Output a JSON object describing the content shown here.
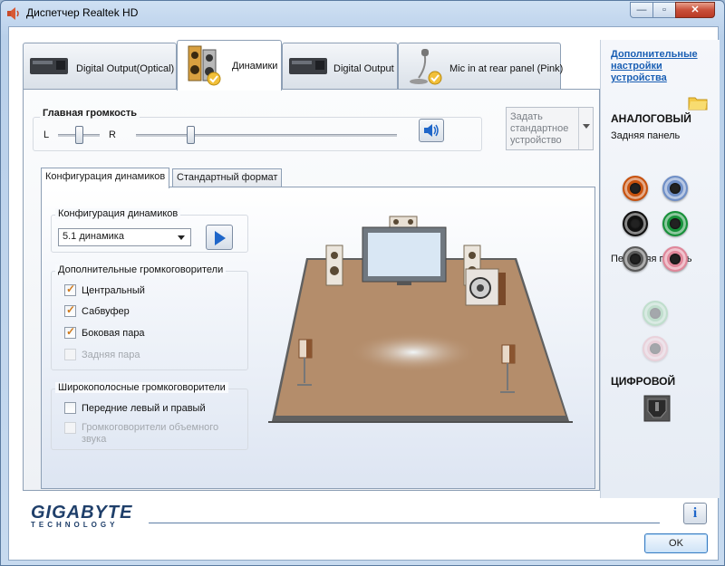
{
  "window": {
    "title": "Диспетчер Realtek HD"
  },
  "main_tabs": [
    {
      "label": "Digital Output(Optical)",
      "active": false
    },
    {
      "label": "Динамики",
      "active": true
    },
    {
      "label": "Digital Output",
      "active": false
    },
    {
      "label": "Mic in at rear panel (Pink)",
      "active": false
    }
  ],
  "volume": {
    "title": "Главная громкость",
    "left_label": "L",
    "right_label": "R",
    "balance_percent": 50,
    "level_percent": 21
  },
  "default_device": {
    "label": "Задать стандартное устройство"
  },
  "sub_tabs": [
    {
      "label": "Конфигурация динамиков",
      "active": true
    },
    {
      "label": "Стандартный формат",
      "active": false
    }
  ],
  "speaker_config": {
    "group_title": "Конфигурация динамиков",
    "selected": "5.1 динамика"
  },
  "extra_speakers": {
    "group_title": "Дополнительные громкоговорители",
    "items": [
      {
        "label": "Центральный",
        "checked": true,
        "enabled": true
      },
      {
        "label": "Сабвуфер",
        "checked": true,
        "enabled": true
      },
      {
        "label": "Боковая пара",
        "checked": true,
        "enabled": true
      },
      {
        "label": "Задняя пара",
        "checked": false,
        "enabled": false
      }
    ]
  },
  "fullrange": {
    "group_title": "Широкополосные громкоговорители",
    "items": [
      {
        "label": "Передние левый и правый",
        "checked": false,
        "enabled": true
      },
      {
        "label": "Громкоговорители объемного звука",
        "checked": false,
        "enabled": false
      }
    ]
  },
  "side_panel": {
    "link": "Дополнительные настройки устройства",
    "analog_title": "АНАЛОГОВЫЙ",
    "rear_panel": "Задняя панель",
    "front_panel": "Передняя панель",
    "digital_title": "ЦИФРОВОЙ",
    "rear_jacks": [
      {
        "color": "#c8520e"
      },
      {
        "color": "#6f8fc7"
      },
      {
        "color": "#111111"
      },
      {
        "color": "#17913a"
      },
      {
        "color": "#5a5a5a"
      },
      {
        "color": "#e0879a"
      }
    ],
    "front_jacks": [
      {
        "color": "#6fbf80"
      },
      {
        "color": "#e79aa8"
      }
    ]
  },
  "brand": {
    "name": "GIGABYTE",
    "sub": "TECHNOLOGY"
  },
  "buttons": {
    "ok": "OK",
    "info": "i"
  }
}
